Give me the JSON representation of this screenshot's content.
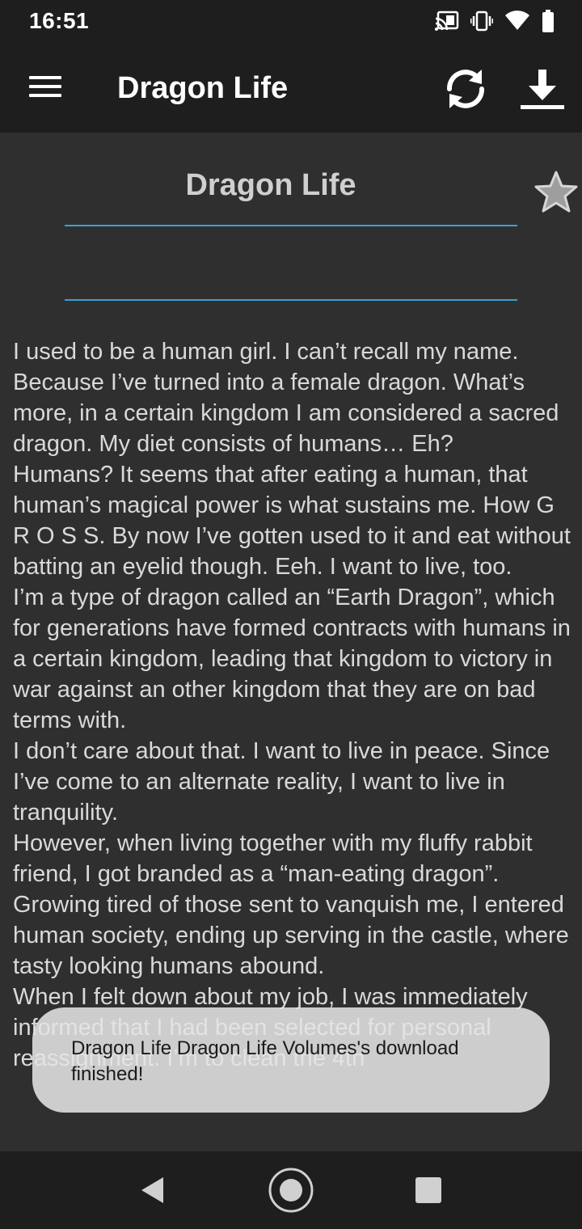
{
  "status_bar": {
    "time": "16:51",
    "icons": [
      "cast-icon",
      "vibrate-icon",
      "wifi-icon",
      "battery-icon"
    ]
  },
  "app_bar": {
    "title": "Dragon Life",
    "menu_icon": "hamburger-menu-icon",
    "actions": [
      "sync-icon",
      "download-icon"
    ]
  },
  "book": {
    "title": "Dragon Life",
    "favorite_icon": "star-icon",
    "synopsis": "I used to be a human girl. I can’t recall my name. Because I’ve turned into a female dragon. What’s more, in a certain kingdom I am considered a sacred dragon. My diet consists of humans… Eh?\nHumans? It seems that after eating a human, that human’s magical power is what sustains me. How G R O S S. By now I’ve gotten used to it and eat without batting an eyelid though. Eeh. I want to live, too.\nI’m a type of dragon called an “Earth Dragon”, which for generations have formed contracts with humans in a certain kingdom, leading that kingdom to victory in war against an other kingdom that they are on bad terms with.\nI don’t care about that. I want to live in peace. Since I’ve come to an alternate reality, I want to live in tranquility.\nHowever, when living together with my fluffy rabbit friend, I got branded as a “man-eating dragon”. Growing tired of those sent to vanquish me, I entered human society, ending up serving in the castle, where tasty looking humans abound.\nWhen I felt down about my job, I was immediately informed that I had been selected for personal reassignment. I’m to clean the 4th"
  },
  "toast": {
    "message": "Dragon Life Dragon Life Volumes's download finished!"
  },
  "nav_bar": {
    "buttons": [
      "back-icon",
      "home-icon",
      "recents-icon"
    ]
  },
  "colors": {
    "app_bar_bg": "#1e1e1e",
    "content_bg": "#2f2f2f",
    "accent_line": "#3aa1d4",
    "text": "#d9d9d9",
    "toast_bg": "#e4e4e4"
  }
}
